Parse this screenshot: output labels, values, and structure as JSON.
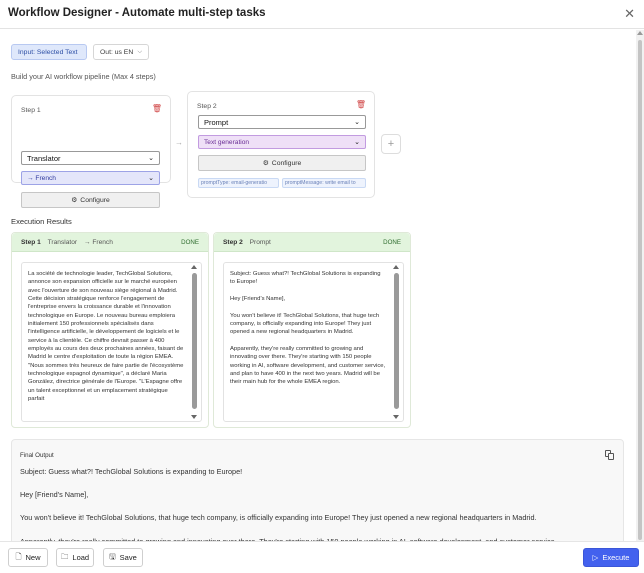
{
  "window": {
    "title": "Workflow Designer - Automate multi-step tasks",
    "close_glyph": "✕"
  },
  "io": {
    "input_label": "Input: Selected Text",
    "out_prefix": "Out:",
    "out_value": "us EN"
  },
  "pipeline": {
    "subtitle": "Build your AI workflow pipeline (Max 4 steps)",
    "steps": [
      {
        "label": "Step 1",
        "type": "Translator",
        "option": "→ French",
        "configure": "Configure",
        "tags": []
      },
      {
        "label": "Step 2",
        "type": "Prompt",
        "option": "Text generation",
        "configure": "Configure",
        "tags": [
          "promptType: email-generatio",
          "promptMessage: write email to"
        ]
      }
    ],
    "add_glyph": "+"
  },
  "results": {
    "heading": "Execution Results",
    "items": [
      {
        "step": "Step 1",
        "name": "Translator",
        "detail": "→ French",
        "status": "DONE",
        "text": "La société de technologie leader, TechGlobal Solutions, annonce son expansion officielle sur le marché européen avec l'ouverture de son nouveau siège régional à Madrid. Cette décision stratégique renforce l'engagement de l'entreprise envers la croissance durable et l'innovation technologique en Europe. Le nouveau bureau emploiera initialement 150 professionnels spécialisés dans l'intelligence artificielle, le développement de logiciels et le service à la clientèle. Ce chiffre devrait passer à 400 employés au cours des deux prochaines années, faisant de Madrid le centre d'exploitation de toute la région EMEA. \"Nous sommes très heureux de faire partie de l'écosystème technologique espagnol dynamique\", a déclaré Maria González, directrice générale de l'Europe. \"L'Espagne offre un talent exceptionnel et un emplacement stratégique parfait"
      },
      {
        "step": "Step 2",
        "name": "Prompt",
        "detail": "",
        "status": "DONE",
        "text": "Subject: Guess what?! TechGlobal Solutions is expanding to Europe!\n\nHey [Friend's Name],\n\nYou won't believe it! TechGlobal Solutions, that huge tech company, is officially expanding into Europe! They just opened a new regional headquarters in Madrid.\n\nApparently, they're really committed to growing and innovating over there. They're starting with 150 people working in AI, software development, and customer service, and plan to have 400 in the next two years. Madrid will be their main hub for the whole EMEA region."
      }
    ]
  },
  "final": {
    "label": "Final Output",
    "text": "Subject: Guess what?! TechGlobal Solutions is expanding to Europe!\n\nHey [Friend's Name],\n\nYou won't believe it! TechGlobal Solutions, that huge tech company, is officially expanding into Europe! They just opened a new regional headquarters in Madrid.\n\nApparently, they're really committed to growing and innovating over there. They're starting with 150 people working in AI, software development, and customer service"
  },
  "footer": {
    "new_label": "New",
    "load_label": "Load",
    "save_label": "Save",
    "execute_label": "Execute"
  },
  "colors": {
    "accent": "#4361ee",
    "done_header": "#e2f4dd",
    "delete": "#d04444"
  }
}
